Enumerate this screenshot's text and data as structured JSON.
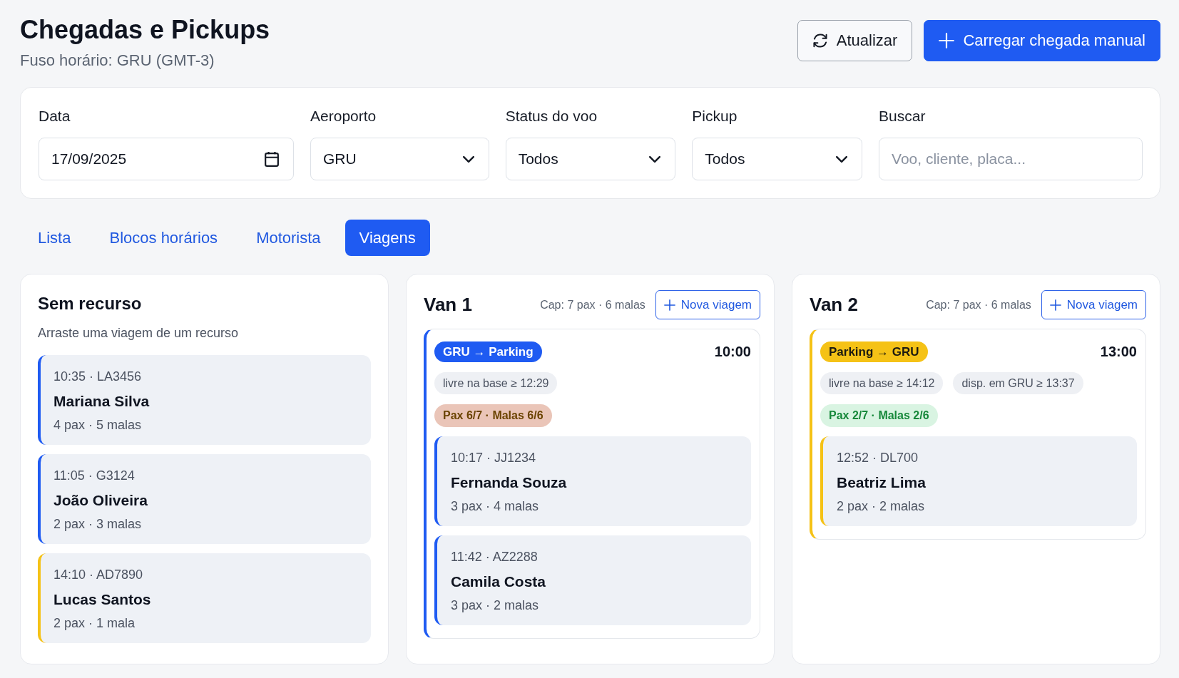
{
  "header": {
    "title": "Chegadas e Pickups",
    "subtitle": "Fuso horário: GRU (GMT-3)",
    "buttons": [
      {
        "kind": "secondary",
        "label": "Atualizar"
      },
      {
        "kind": "primary",
        "label": "Carregar chegada manual"
      }
    ]
  },
  "filters": [
    {
      "kind": "date",
      "label": "Data",
      "value": "17/09/2025"
    },
    {
      "kind": "select",
      "label": "Aeroporto",
      "value": "GRU"
    },
    {
      "kind": "select",
      "label": "Status do voo",
      "value": "Todos"
    },
    {
      "kind": "select",
      "label": "Pickup",
      "value": "Todos"
    },
    {
      "kind": "search",
      "label": "Buscar",
      "placeholder": "Voo, cliente, placa..."
    }
  ],
  "tabs": [
    {
      "label": "Lista",
      "selected": false
    },
    {
      "label": "Blocos horários",
      "selected": false
    },
    {
      "label": "Motorista",
      "selected": false
    },
    {
      "label": "Viagens",
      "selected": true
    }
  ],
  "unassigned": {
    "title": "Sem recurso",
    "hint": "Arraste uma viagem de um recurso",
    "passengers": [
      {
        "flight": "10:35 · LA3456",
        "name": "Mariana Silva",
        "count": "4 pax · 5 malas",
        "color": "#1f5bf2"
      },
      {
        "flight": "11:05 · G3124",
        "name": "João Oliveira",
        "count": "2 pax · 3 malas",
        "color": "#1f5bf2"
      },
      {
        "flight": "14:10 · AD7890",
        "name": "Lucas Santos",
        "count": "2 pax · 1 mala",
        "color": "#f5c216"
      }
    ]
  },
  "resources": [
    {
      "title": "Van 1",
      "capacity": "Cap: 7 pax · 6 malas",
      "button": "Nova viagem",
      "trips": [
        {
          "route": "GRU → Parking",
          "color": "#1f5bf2",
          "time": "10:00",
          "chips": [
            "livre na base ≥ 12:29"
          ],
          "load": {
            "text": "Pax 6/7 · Malas 6/6",
            "full": true
          },
          "passengers": [
            {
              "flight": "10:17 · JJ1234",
              "name": "Fernanda Souza",
              "count": "3 pax · 4 malas",
              "color": "#1f5bf2"
            },
            {
              "flight": "11:42 · AZ2288",
              "name": "Camila Costa",
              "count": "3 pax · 2 malas",
              "color": "#1f5bf2"
            }
          ]
        }
      ]
    },
    {
      "title": "Van 2",
      "capacity": "Cap: 7 pax · 6 malas",
      "button": "Nova viagem",
      "trips": [
        {
          "route": "Parking → GRU",
          "color": "#f5c216",
          "time": "13:00",
          "chips": [
            "livre na base ≥ 14:12",
            "disp. em GRU ≥ 13:37"
          ],
          "load": {
            "text": "Pax 2/7 · Malas 2/6",
            "full": false
          },
          "passengers": [
            {
              "flight": "12:52 · DL700",
              "name": "Beatriz Lima",
              "count": "2 pax · 2 malas",
              "color": "#f5c216"
            }
          ]
        }
      ]
    }
  ]
}
